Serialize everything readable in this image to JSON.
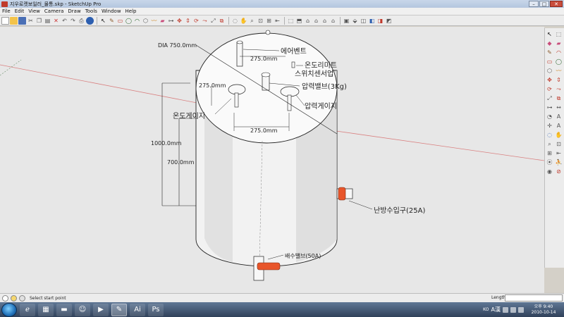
{
  "window": {
    "title": "지우로켓보일러_물통.skp - SketchUp Pro",
    "controls": [
      "–",
      "□",
      "✕"
    ]
  },
  "menu": [
    "File",
    "Edit",
    "View",
    "Camera",
    "Draw",
    "Tools",
    "Window",
    "Help"
  ],
  "model": {
    "dimensions": {
      "diameter": "DIA 750.0mm",
      "top_spacing_1": "275.0mm",
      "top_spacing_2": "275.0mm",
      "top_spacing_3": "275.0mm",
      "height_total": "1000.0mm",
      "height_inlet": "700.0mm"
    },
    "labels": {
      "air_vent": "에어벤트",
      "limit_switch_line1": "온도리미트",
      "limit_switch_line2": "스위치센서업",
      "pressure_valve": "압력밸브(3Kg)",
      "temp_gauge": "온도게이지",
      "pressure_gauge": "압력게이지",
      "heating_inlet": "난방수입구(25A)",
      "drain_valve": "배수밸브(50A)"
    },
    "colors": {
      "fitting_orange": "#e8552a",
      "model_face": "#f2f2f2"
    }
  },
  "statusbar": {
    "hint": "Select start point",
    "vcb_label": "Length",
    "vcb_value": ""
  },
  "taskbar": {
    "lang": "KO",
    "ime": "A漢",
    "time": "오후 9:40",
    "date": "2010-10-14"
  }
}
